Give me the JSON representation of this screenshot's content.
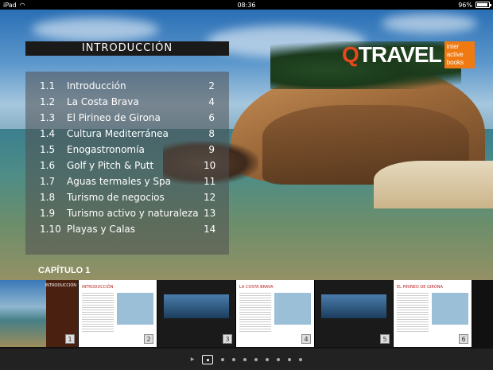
{
  "status": {
    "device": "iPad",
    "time": "08:36",
    "battery_pct": "96%",
    "battery_level": 0.96
  },
  "logo": {
    "q": "Q",
    "travel": "TRAVEL",
    "badge_lines": [
      "inter",
      "active",
      "books"
    ]
  },
  "toc": {
    "title": "INTRODUCCIÓN",
    "items": [
      {
        "num": "1.1",
        "label": "Introducción",
        "page": "2"
      },
      {
        "num": "1.2",
        "label": "La Costa Brava",
        "page": "4"
      },
      {
        "num": "1.3",
        "label": "El Pirineo de Girona",
        "page": "6"
      },
      {
        "num": "1.4",
        "label": "Cultura Mediterránea",
        "page": "8"
      },
      {
        "num": "1.5",
        "label": "Enogastronomía",
        "page": "9"
      },
      {
        "num": "1.6",
        "label": "Golf y Pitch & Putt",
        "page": "10"
      },
      {
        "num": "1.7",
        "label": "Aguas termales y Spa",
        "page": "11"
      },
      {
        "num": "1.8",
        "label": "Turismo de negocios",
        "page": "12"
      },
      {
        "num": "1.9",
        "label": "Turismo activo y naturaleza",
        "page": "13"
      },
      {
        "num": "1.10",
        "label": "Playas y Calas",
        "page": "14"
      }
    ]
  },
  "chapter": "CAPÍTULO 1",
  "thumbnails": [
    {
      "num": "1",
      "kind": "cover",
      "title": "INTRODUCCIÓN"
    },
    {
      "num": "2",
      "kind": "page",
      "title": "INTRODUCCIÓN"
    },
    {
      "num": "3",
      "kind": "dark",
      "title": ""
    },
    {
      "num": "4",
      "kind": "page",
      "title": "LA COSTA BRAVA"
    },
    {
      "num": "5",
      "kind": "dark",
      "title": ""
    },
    {
      "num": "6",
      "kind": "page",
      "title": "EL PIRINEO DE GIRONA"
    }
  ],
  "pager": {
    "count": 9,
    "active": 0
  }
}
